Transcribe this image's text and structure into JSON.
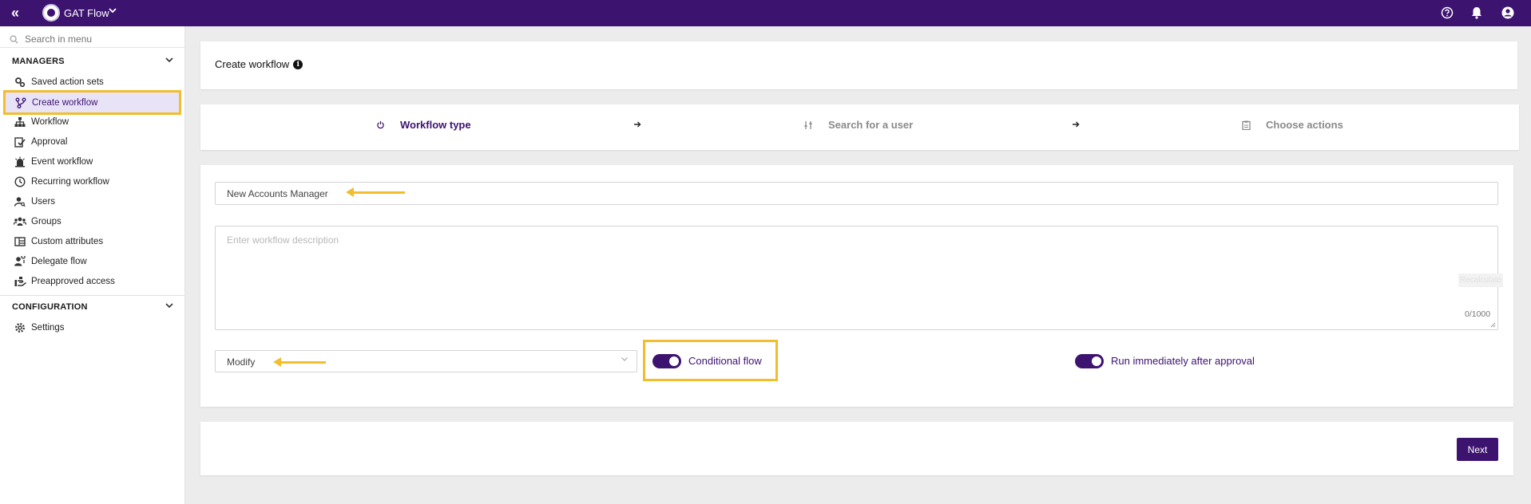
{
  "app": {
    "name": "GAT Flow"
  },
  "sidebar": {
    "search_placeholder": "Search in menu",
    "managers_title": "MANAGERS",
    "items": [
      {
        "label": "Saved action sets",
        "icon": "gears-icon"
      },
      {
        "label": "Create workflow",
        "icon": "branch-icon"
      },
      {
        "label": "Workflow",
        "icon": "sitemap-icon"
      },
      {
        "label": "Approval",
        "icon": "checklist-icon"
      },
      {
        "label": "Event workflow",
        "icon": "alarm-icon"
      },
      {
        "label": "Recurring workflow",
        "icon": "clock-icon"
      },
      {
        "label": "Users",
        "icon": "user-search-icon"
      },
      {
        "label": "Groups",
        "icon": "group-icon"
      },
      {
        "label": "Custom attributes",
        "icon": "table-columns-icon"
      },
      {
        "label": "Delegate flow",
        "icon": "user-key-icon"
      },
      {
        "label": "Preapproved access",
        "icon": "hand-icon"
      }
    ],
    "configuration_title": "CONFIGURATION",
    "config_items": [
      {
        "label": "Settings",
        "icon": "gear-icon"
      }
    ]
  },
  "page": {
    "title": "Create workflow"
  },
  "steps": [
    {
      "label": "Workflow type",
      "icon": "power-icon",
      "active": true
    },
    {
      "label": "Search for a user",
      "icon": "sliders-icon",
      "active": false
    },
    {
      "label": "Choose actions",
      "icon": "clipboard-icon",
      "active": false
    }
  ],
  "form": {
    "name_value": "New Accounts Manager",
    "description_placeholder": "Enter workflow description",
    "recalculate_label": "Recalculate",
    "char_counter": "0/1000",
    "type_value": "Modify",
    "conditional_flow_label": "Conditional flow",
    "conditional_flow_on": true,
    "run_immediately_label": "Run immediately after approval",
    "run_immediately_on": true
  },
  "footer": {
    "next_label": "Next"
  },
  "colors": {
    "brand": "#3d1370",
    "highlight": "#f2be2e",
    "active_bg": "#e8e3f7"
  }
}
